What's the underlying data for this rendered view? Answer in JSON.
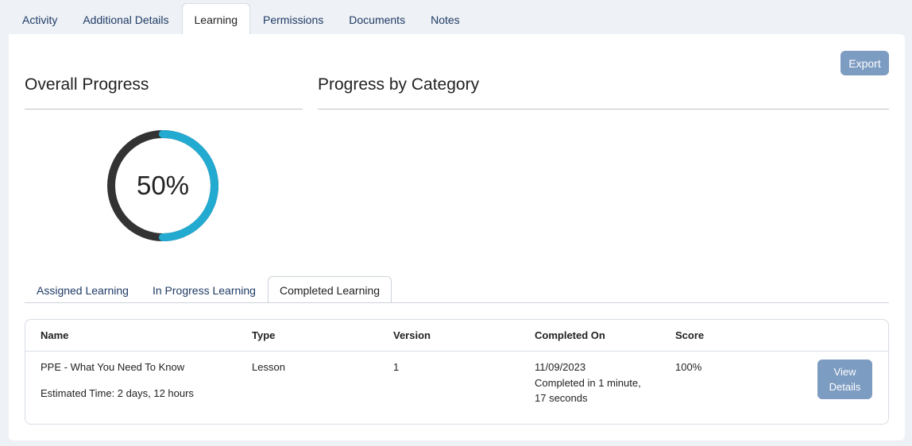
{
  "tabs": [
    "Activity",
    "Additional Details",
    "Learning",
    "Permissions",
    "Documents",
    "Notes"
  ],
  "active_tab": "Learning",
  "export_label": "Export",
  "overall": {
    "title": "Overall Progress",
    "percent_label": "50%",
    "fraction": 0.5
  },
  "category": {
    "title": "Progress by Category"
  },
  "sub_tabs": [
    "Assigned Learning",
    "In Progress Learning",
    "Completed Learning"
  ],
  "active_sub_tab": "Completed Learning",
  "table": {
    "headers": {
      "name": "Name",
      "type": "Type",
      "version": "Version",
      "completed_on": "Completed On",
      "score": "Score"
    },
    "rows": [
      {
        "name": "PPE - What You Need To Know",
        "estimated": "Estimated Time: 2 days, 12 hours",
        "type": "Lesson",
        "version": "1",
        "date": "11/09/2023",
        "duration_line1": "Completed in 1 minute,",
        "duration_line2": "17 seconds",
        "score": "100%",
        "action_line1": "View",
        "action_line2": "Details"
      }
    ]
  },
  "colors": {
    "accent": "#22aad1",
    "track": "#333333",
    "button": "#7d9cc2",
    "link": "#1f3b66"
  }
}
